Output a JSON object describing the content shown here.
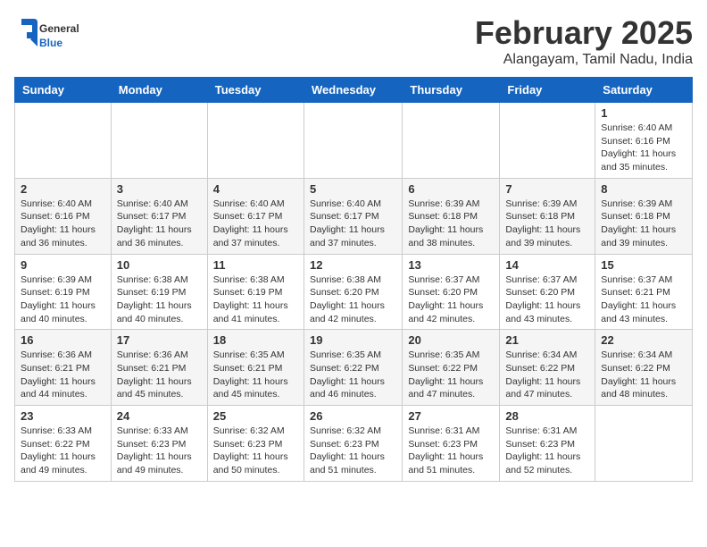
{
  "header": {
    "logo_general": "General",
    "logo_blue": "Blue",
    "month_title": "February 2025",
    "subtitle": "Alangayam, Tamil Nadu, India"
  },
  "calendar": {
    "days_of_week": [
      "Sunday",
      "Monday",
      "Tuesday",
      "Wednesday",
      "Thursday",
      "Friday",
      "Saturday"
    ],
    "weeks": [
      [
        {
          "day": "",
          "info": ""
        },
        {
          "day": "",
          "info": ""
        },
        {
          "day": "",
          "info": ""
        },
        {
          "day": "",
          "info": ""
        },
        {
          "day": "",
          "info": ""
        },
        {
          "day": "",
          "info": ""
        },
        {
          "day": "1",
          "info": "Sunrise: 6:40 AM\nSunset: 6:16 PM\nDaylight: 11 hours and 35 minutes."
        }
      ],
      [
        {
          "day": "2",
          "info": "Sunrise: 6:40 AM\nSunset: 6:16 PM\nDaylight: 11 hours and 36 minutes."
        },
        {
          "day": "3",
          "info": "Sunrise: 6:40 AM\nSunset: 6:17 PM\nDaylight: 11 hours and 36 minutes."
        },
        {
          "day": "4",
          "info": "Sunrise: 6:40 AM\nSunset: 6:17 PM\nDaylight: 11 hours and 37 minutes."
        },
        {
          "day": "5",
          "info": "Sunrise: 6:40 AM\nSunset: 6:17 PM\nDaylight: 11 hours and 37 minutes."
        },
        {
          "day": "6",
          "info": "Sunrise: 6:39 AM\nSunset: 6:18 PM\nDaylight: 11 hours and 38 minutes."
        },
        {
          "day": "7",
          "info": "Sunrise: 6:39 AM\nSunset: 6:18 PM\nDaylight: 11 hours and 39 minutes."
        },
        {
          "day": "8",
          "info": "Sunrise: 6:39 AM\nSunset: 6:18 PM\nDaylight: 11 hours and 39 minutes."
        }
      ],
      [
        {
          "day": "9",
          "info": "Sunrise: 6:39 AM\nSunset: 6:19 PM\nDaylight: 11 hours and 40 minutes."
        },
        {
          "day": "10",
          "info": "Sunrise: 6:38 AM\nSunset: 6:19 PM\nDaylight: 11 hours and 40 minutes."
        },
        {
          "day": "11",
          "info": "Sunrise: 6:38 AM\nSunset: 6:19 PM\nDaylight: 11 hours and 41 minutes."
        },
        {
          "day": "12",
          "info": "Sunrise: 6:38 AM\nSunset: 6:20 PM\nDaylight: 11 hours and 42 minutes."
        },
        {
          "day": "13",
          "info": "Sunrise: 6:37 AM\nSunset: 6:20 PM\nDaylight: 11 hours and 42 minutes."
        },
        {
          "day": "14",
          "info": "Sunrise: 6:37 AM\nSunset: 6:20 PM\nDaylight: 11 hours and 43 minutes."
        },
        {
          "day": "15",
          "info": "Sunrise: 6:37 AM\nSunset: 6:21 PM\nDaylight: 11 hours and 43 minutes."
        }
      ],
      [
        {
          "day": "16",
          "info": "Sunrise: 6:36 AM\nSunset: 6:21 PM\nDaylight: 11 hours and 44 minutes."
        },
        {
          "day": "17",
          "info": "Sunrise: 6:36 AM\nSunset: 6:21 PM\nDaylight: 11 hours and 45 minutes."
        },
        {
          "day": "18",
          "info": "Sunrise: 6:35 AM\nSunset: 6:21 PM\nDaylight: 11 hours and 45 minutes."
        },
        {
          "day": "19",
          "info": "Sunrise: 6:35 AM\nSunset: 6:22 PM\nDaylight: 11 hours and 46 minutes."
        },
        {
          "day": "20",
          "info": "Sunrise: 6:35 AM\nSunset: 6:22 PM\nDaylight: 11 hours and 47 minutes."
        },
        {
          "day": "21",
          "info": "Sunrise: 6:34 AM\nSunset: 6:22 PM\nDaylight: 11 hours and 47 minutes."
        },
        {
          "day": "22",
          "info": "Sunrise: 6:34 AM\nSunset: 6:22 PM\nDaylight: 11 hours and 48 minutes."
        }
      ],
      [
        {
          "day": "23",
          "info": "Sunrise: 6:33 AM\nSunset: 6:22 PM\nDaylight: 11 hours and 49 minutes."
        },
        {
          "day": "24",
          "info": "Sunrise: 6:33 AM\nSunset: 6:23 PM\nDaylight: 11 hours and 49 minutes."
        },
        {
          "day": "25",
          "info": "Sunrise: 6:32 AM\nSunset: 6:23 PM\nDaylight: 11 hours and 50 minutes."
        },
        {
          "day": "26",
          "info": "Sunrise: 6:32 AM\nSunset: 6:23 PM\nDaylight: 11 hours and 51 minutes."
        },
        {
          "day": "27",
          "info": "Sunrise: 6:31 AM\nSunset: 6:23 PM\nDaylight: 11 hours and 51 minutes."
        },
        {
          "day": "28",
          "info": "Sunrise: 6:31 AM\nSunset: 6:23 PM\nDaylight: 11 hours and 52 minutes."
        },
        {
          "day": "",
          "info": ""
        }
      ]
    ]
  }
}
